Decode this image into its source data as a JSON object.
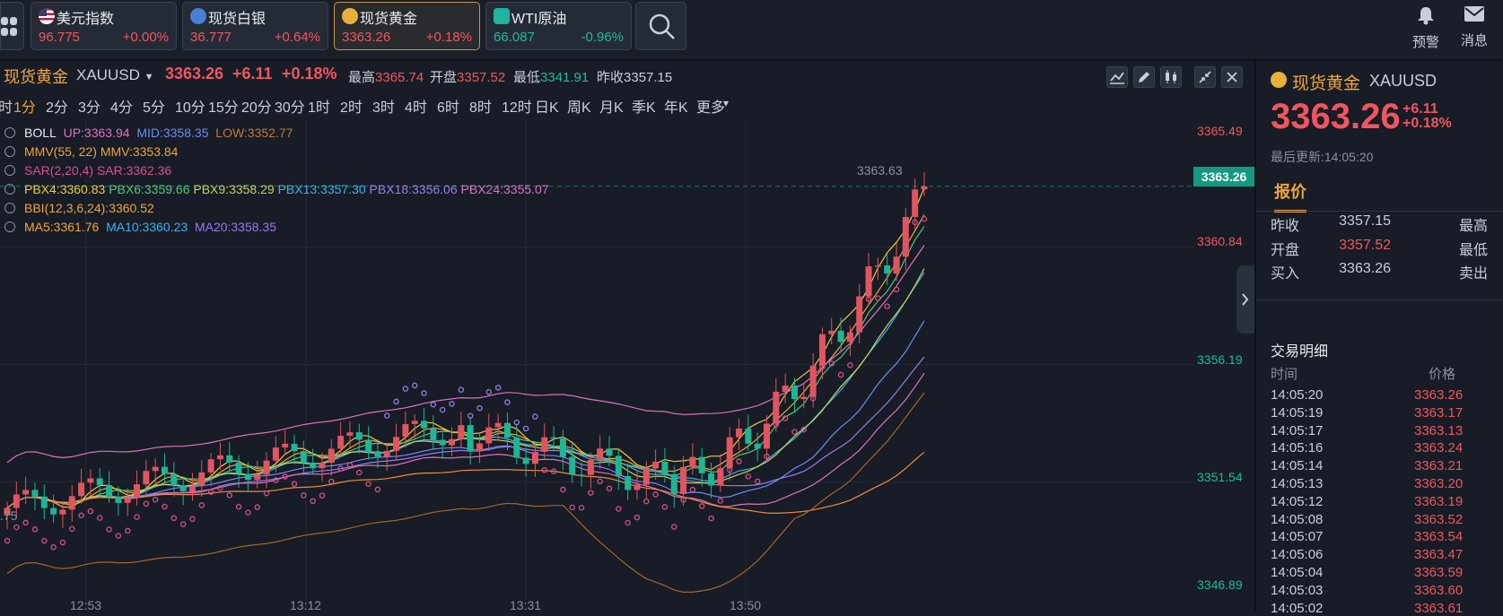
{
  "top_bar": {
    "quotes": [
      {
        "name": "美元指数",
        "price": "96.775",
        "change": "+0.00%",
        "dir": "up",
        "icon": "us-flag-icon"
      },
      {
        "name": "现货白银",
        "price": "36.777",
        "change": "+0.64%",
        "dir": "up",
        "icon": "silver-coin-icon"
      },
      {
        "name": "现货黄金",
        "price": "3363.26",
        "change": "+0.18%",
        "dir": "up",
        "icon": "gold-coin-icon"
      },
      {
        "name": "WTI原油",
        "price": "66.087",
        "change": "-0.96%",
        "dir": "down",
        "icon": "oil-icon"
      }
    ],
    "alert_label": "预警",
    "message_label": "消息"
  },
  "chart_header": {
    "title": "现货黄金",
    "symbol": "XAUUSD",
    "price": "3363.26",
    "change": "+6.11",
    "pct": "+0.18%",
    "high_label": "最高",
    "high": "3365.74",
    "open_label": "开盘",
    "open": "3357.52",
    "low_label": "最低",
    "low": "3341.91",
    "prev_label": "昨收",
    "prev": "3357.15"
  },
  "periods": [
    "时",
    "1分",
    "2分",
    "3分",
    "4分",
    "5分",
    "10分",
    "15分",
    "20分",
    "30分",
    "1时",
    "2时",
    "3时",
    "4时",
    "6时",
    "8时",
    "12时",
    "日K",
    "周K",
    "月K",
    "季K",
    "年K",
    "更多"
  ],
  "active_period": "1分",
  "indicators": {
    "boll": {
      "name": "BOLL",
      "up": "UP:3363.94",
      "mid": "MID:3358.35",
      "low": "LOW:3352.77"
    },
    "mmv": {
      "name": "MMV(55, 22)",
      "val": "MMV:3353.84"
    },
    "sar": {
      "name": "SAR(2,20,4)",
      "val": "SAR:3362.36"
    },
    "pbx": [
      "PBX4:3360.83",
      "PBX6:3359.66",
      "PBX9:3358.29",
      "PBX13:3357.30",
      "PBX18:3356.06",
      "PBX24:3355.07"
    ],
    "bbi": "BBI(12,3,6,24):3360.52",
    "ma": [
      "MA5:3361.76",
      "MA10:3360.23",
      "MA20:3358.35"
    ]
  },
  "chart_data": {
    "type": "candlestick",
    "price_axis": [
      "3365.49",
      "3360.84",
      "3356.19",
      "3351.54",
      "3346.89"
    ],
    "current_tag": "3363.26",
    "last_hint": "3363.63",
    "left_edge_label": ".75",
    "time_axis": [
      "12:53",
      "13:12",
      "13:31",
      "13:50"
    ],
    "ylim": [
      3346.89,
      3365.49
    ]
  },
  "side_panel": {
    "title": "现货黄金",
    "symbol": "XAUUSD",
    "price": "3363.26",
    "change": "+6.11",
    "pct": "+0.18%",
    "updated": "最后更新:14:05:20",
    "tab": "报价",
    "rows": [
      {
        "k": "昨收",
        "v": "3357.15",
        "k2": "最高",
        "dir": "flat"
      },
      {
        "k": "开盘",
        "v": "3357.52",
        "k2": "最低",
        "dir": "up"
      },
      {
        "k": "买入",
        "v": "3363.26",
        "k2": "卖出",
        "dir": "flat"
      }
    ],
    "trades_title": "交易明细",
    "col_time": "时间",
    "col_price": "价格",
    "trades": [
      {
        "t": "14:05:20",
        "p": "3363.26"
      },
      {
        "t": "14:05:19",
        "p": "3363.17"
      },
      {
        "t": "14:05:17",
        "p": "3363.13"
      },
      {
        "t": "14:05:16",
        "p": "3363.24"
      },
      {
        "t": "14:05:14",
        "p": "3363.21"
      },
      {
        "t": "14:05:13",
        "p": "3363.20"
      },
      {
        "t": "14:05:12",
        "p": "3363.19"
      },
      {
        "t": "14:05:08",
        "p": "3363.52"
      },
      {
        "t": "14:05:07",
        "p": "3363.54"
      },
      {
        "t": "14:05:06",
        "p": "3363.47"
      },
      {
        "t": "14:05:04",
        "p": "3363.59"
      },
      {
        "t": "14:05:03",
        "p": "3363.60"
      },
      {
        "t": "14:05:02",
        "p": "3363.61"
      }
    ]
  }
}
